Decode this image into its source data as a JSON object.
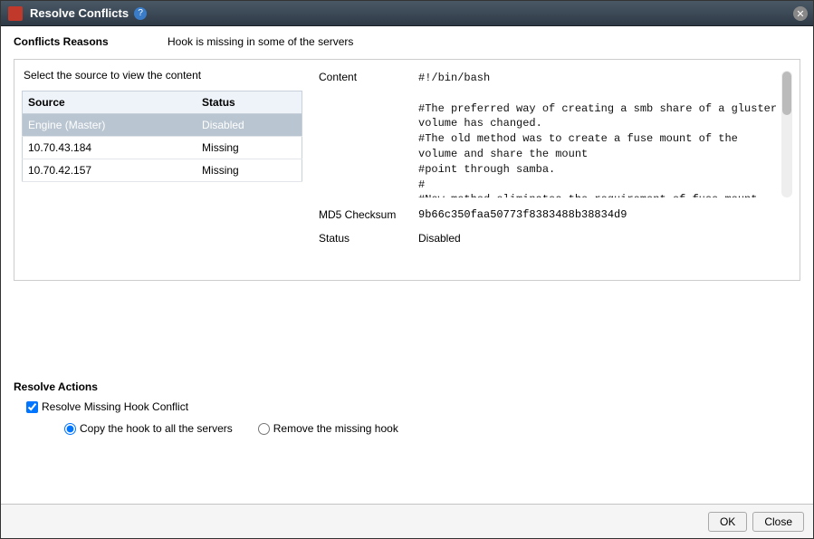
{
  "titlebar": {
    "title": "Resolve Conflicts",
    "help_glyph": "?"
  },
  "conflict_reasons": {
    "label": "Conflicts Reasons",
    "text": "Hook is missing in some of the servers"
  },
  "source_panel": {
    "hint": "Select the source to view the content",
    "columns": {
      "source": "Source",
      "status": "Status"
    },
    "rows": [
      {
        "source": "Engine (Master)",
        "status": "Disabled",
        "selected": true
      },
      {
        "source": "10.70.43.184",
        "status": "Missing",
        "selected": false
      },
      {
        "source": "10.70.42.157",
        "status": "Missing",
        "selected": false
      }
    ]
  },
  "detail": {
    "content_label": "Content",
    "content_text": "#!/bin/bash\n\n#The preferred way of creating a smb share of a gluster volume has changed.\n#The old method was to create a fuse mount of the volume and share the mount\n#point through samba.\n#\n#New method eliminates the requirement of fuse mount and changes in fstab.\n#glusterfs vfs plugin for samba makes call to libgfapi",
    "md5_label": "MD5 Checksum",
    "md5_value": "9b66c350faa50773f8383488b38834d9",
    "status_label": "Status",
    "status_value": "Disabled"
  },
  "resolve": {
    "title": "Resolve Actions",
    "checkbox_label": "Resolve Missing Hook Conflict",
    "checkbox_checked": true,
    "radio_copy": "Copy the hook to all the servers",
    "radio_remove": "Remove the missing hook",
    "radio_selected": "copy"
  },
  "footer": {
    "ok": "OK",
    "close": "Close"
  }
}
